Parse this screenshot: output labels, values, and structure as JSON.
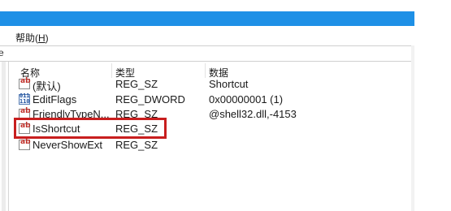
{
  "menu": {
    "help_label": "帮助(",
    "help_key": "H",
    "help_close": ")"
  },
  "address_edge": "e",
  "columns": {
    "name": "名称",
    "type": "类型",
    "data": "数据"
  },
  "rows": [
    {
      "name": "(默认)",
      "type": "REG_SZ",
      "data": "Shortcut",
      "icon": "string-value-icon"
    },
    {
      "name": "EditFlags",
      "type": "REG_DWORD",
      "data": "0x00000001 (1)",
      "icon": "binary-value-icon"
    },
    {
      "name": "FriendlyTypeN...",
      "type": "REG_SZ",
      "data": "@shell32.dll,-4153",
      "icon": "string-value-icon"
    },
    {
      "name": "IsShortcut",
      "type": "REG_SZ",
      "data": "",
      "icon": "string-value-icon"
    },
    {
      "name": "NeverShowExt",
      "type": "REG_SZ",
      "data": "",
      "icon": "string-value-icon"
    }
  ],
  "colors": {
    "titlebar": "#1e90e6",
    "highlight": "#c81e1e"
  }
}
